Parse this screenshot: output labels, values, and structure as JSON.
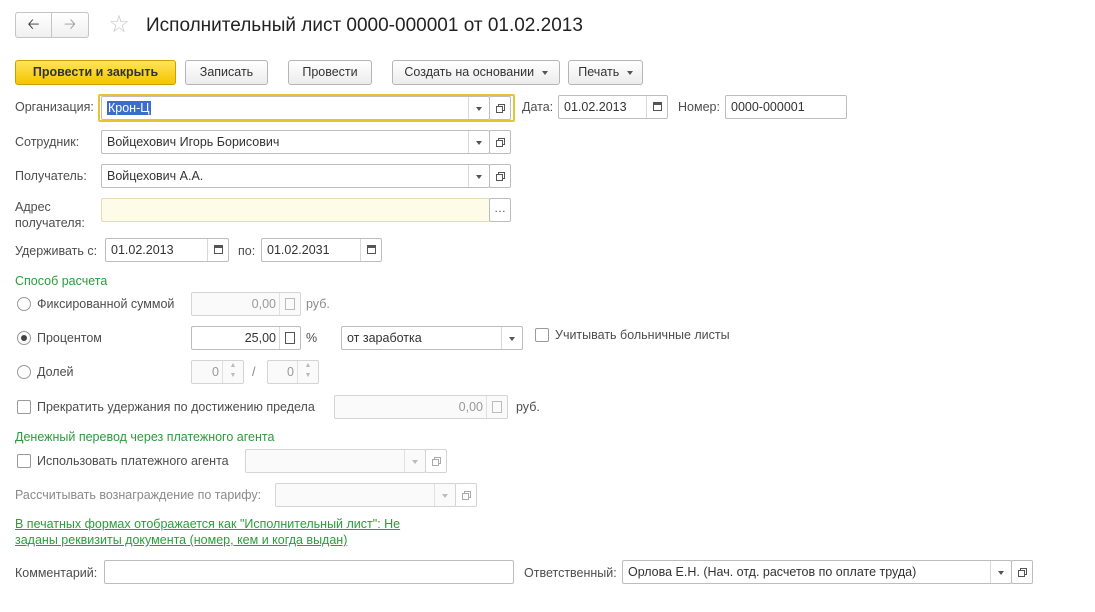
{
  "header": {
    "title": "Исполнительный лист 0000-000001 от 01.02.2013"
  },
  "toolbar": {
    "post_close": "Провести и закрыть",
    "save": "Записать",
    "post": "Провести",
    "create_based": "Создать на основании",
    "print": "Печать"
  },
  "form": {
    "org_label": "Организация:",
    "org_value": "Крон-Ц",
    "date_label": "Дата:",
    "date_value": "01.02.2013",
    "number_label": "Номер:",
    "number_value": "0000-000001",
    "employee_label": "Сотрудник:",
    "employee_value": "Войцехович Игорь Борисович",
    "recipient_label": "Получатель:",
    "recipient_value": "Войцехович А.А.",
    "address_label_1": "Адрес",
    "address_label_2": "получателя:",
    "address_value": "",
    "withhold_from_label": "Удерживать с:",
    "withhold_from_value": "01.02.2013",
    "to_label": "по:",
    "to_value": "01.02.2031",
    "calc_section": "Способ расчета",
    "fixed_label": "Фиксированной суммой",
    "fixed_value": "0,00",
    "rub": "руб.",
    "percent_label": "Процентом",
    "percent_value": "25,00",
    "percent_sign": "%",
    "percent_base": "от заработка",
    "sick_leave_label": "Учитывать больничные листы",
    "share_label": "Долей",
    "share_num": "0",
    "share_sep": "/",
    "share_den": "0",
    "stop_limit_label": "Прекратить удержания по достижению предела",
    "stop_limit_value": "0,00",
    "transfer_section": "Денежный перевод через платежного агента",
    "use_agent_label": "Использовать платежного агента",
    "agent_value": "",
    "tariff_label": "Рассчитывать вознаграждение по тарифу:",
    "tariff_value": "",
    "print_note_1": "В печатных формах отображается как \"Исполнительный лист\": Не",
    "print_note_2": "заданы реквизиты документа (номер, кем и когда выдан)",
    "comment_label": "Комментарий:",
    "comment_value": "",
    "responsible_label": "Ответственный:",
    "responsible_value": "Орлова Е.Н. (Нач. отд. расчетов по оплате труда)"
  },
  "calc_method": "percent",
  "colors": {
    "primary_button": "#f5c500",
    "section_green": "#2a9d3a",
    "focus_border": "#e8c530",
    "address_bg": "#fffbe9"
  }
}
